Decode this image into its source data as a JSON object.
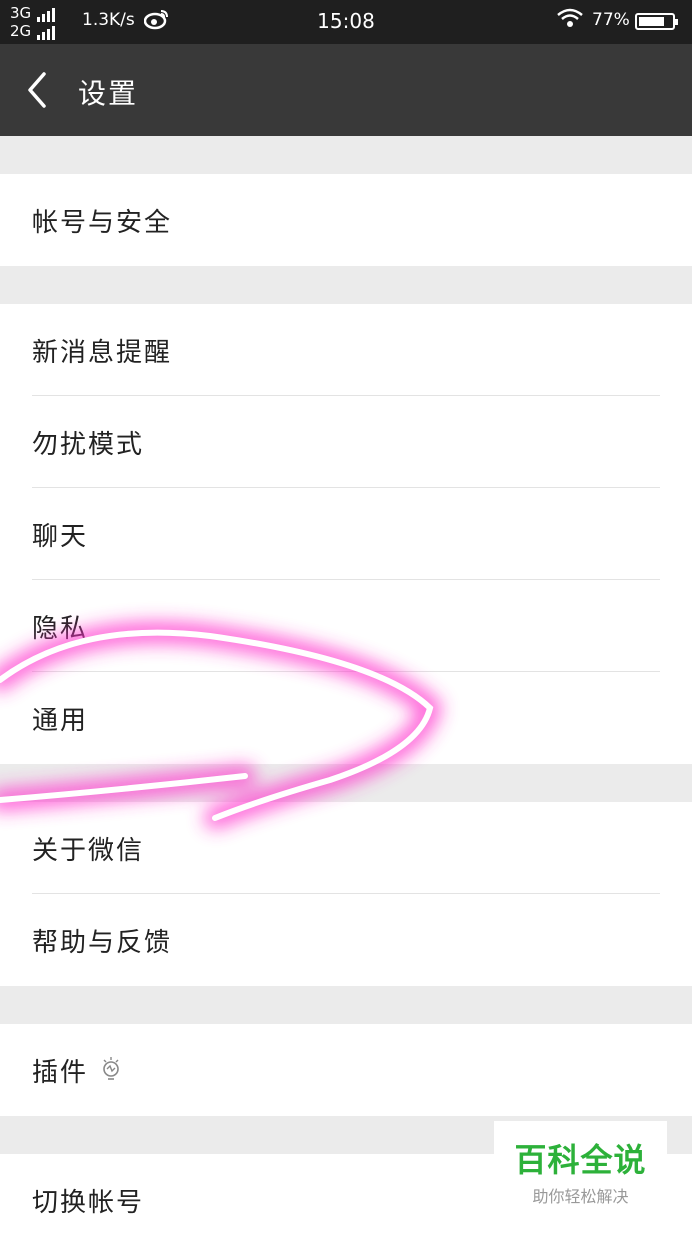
{
  "status_bar": {
    "network_top": "3G",
    "network_bottom": "2G",
    "speed": "1.3K/s",
    "time": "15:08",
    "battery_percent_text": "77%",
    "battery_level": 0.77,
    "weibo_icon": "weibo-icon",
    "wifi_icon": "wifi-icon"
  },
  "nav": {
    "back_icon": "chevron-left-icon",
    "title": "设置"
  },
  "groups": [
    {
      "items": [
        {
          "label": "帐号与安全"
        }
      ]
    },
    {
      "items": [
        {
          "label": "新消息提醒"
        },
        {
          "label": "勿扰模式"
        },
        {
          "label": "聊天"
        },
        {
          "label": "隐私"
        },
        {
          "label": "通用"
        }
      ]
    },
    {
      "items": [
        {
          "label": "关于微信"
        },
        {
          "label": "帮助与反馈"
        }
      ]
    },
    {
      "items": [
        {
          "label": "插件",
          "icon": "lightbulb-icon"
        }
      ]
    },
    {
      "items": [
        {
          "label": "切换帐号"
        }
      ]
    }
  ],
  "annotation": {
    "color": "#ff33cc",
    "circled_item": "通用"
  },
  "watermark": {
    "title": "百科全说",
    "subtitle": "助你轻松解决",
    "color": "#2db13a"
  }
}
